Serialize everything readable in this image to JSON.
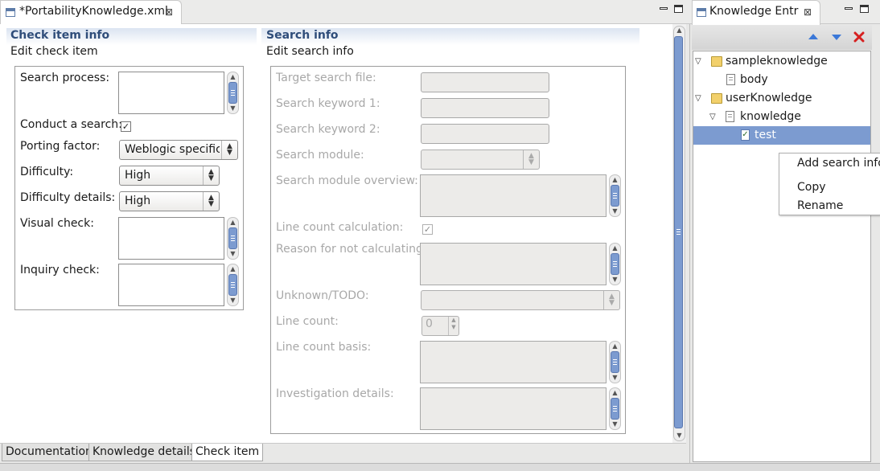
{
  "editor": {
    "tab_title": "*PortabilityKnowledge.xml",
    "check_item_section": {
      "title": "Check item info",
      "description": "Edit check item",
      "search_process_label": "Search process:",
      "conduct_search_label": "Conduct a search:",
      "conduct_search_checked": true,
      "porting_factor_label": "Porting factor:",
      "porting_factor_value": "Weblogic specific",
      "difficulty_label": "Difficulty:",
      "difficulty_value": "High",
      "difficulty_details_label": "Difficulty details:",
      "difficulty_details_value": "High",
      "visual_check_label": "Visual check:",
      "inquiry_check_label": "Inquiry check:"
    },
    "search_section": {
      "title": "Search info",
      "description": "Edit search info",
      "target_search_file_label": "Target search file:",
      "search_keyword1_label": "Search keyword 1:",
      "search_keyword2_label": "Search keyword 2:",
      "search_module_label": "Search module:",
      "search_module_overview_label": "Search module overview:",
      "line_count_calc_label": "Line count calculation:",
      "line_count_calc_checked": true,
      "reason_not_calc_label": "Reason for not calculating:",
      "unknown_todo_label": "Unknown/TODO:",
      "line_count_label": "Line count:",
      "line_count_value": "0",
      "line_count_basis_label": "Line count basis:",
      "investigation_details_label": "Investigation details:"
    },
    "page_tabs": [
      "Documentation",
      "Knowledge details",
      "Check item"
    ],
    "active_page_tab": "Check item"
  },
  "knowledge_view": {
    "tab_title": "Knowledge Entr",
    "toolbar": {
      "up_icon": "arrow-up-icon",
      "down_icon": "arrow-down-icon",
      "delete_icon": "delete-icon"
    },
    "tree": [
      {
        "label": "sampleknowledge",
        "type": "folder",
        "expanded": true
      },
      {
        "label": "body",
        "type": "file"
      },
      {
        "label": "userKnowledge",
        "type": "folder",
        "expanded": true
      },
      {
        "label": "knowledge",
        "type": "file",
        "expanded": true
      },
      {
        "label": "test",
        "type": "check-file",
        "selected": true
      }
    ]
  },
  "context_menu": {
    "items": [
      "Add search info",
      "Copy",
      "Rename"
    ]
  },
  "colors": {
    "section_title": "#2f4d7a",
    "selection": "#7c9bd0",
    "disabled_text": "#a8a8a8",
    "delete_red": "#d62020",
    "arrow_blue": "#3b78d8"
  }
}
